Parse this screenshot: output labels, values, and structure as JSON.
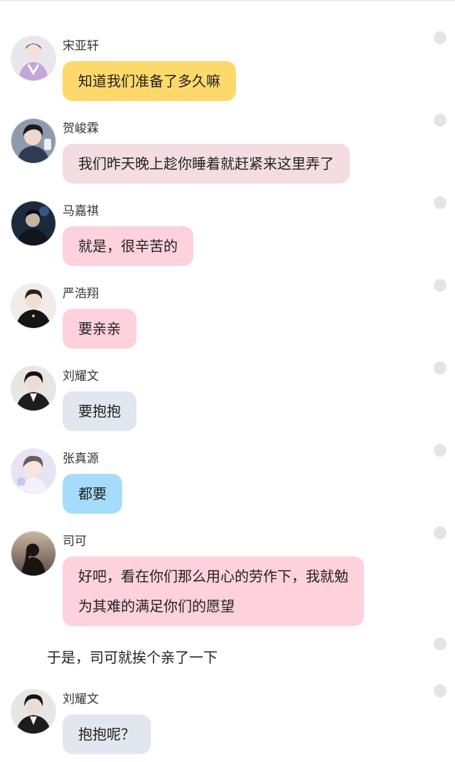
{
  "messages": [
    {
      "name": "宋亚轩",
      "text": "知道我们准备了多久嘛",
      "bubble_color": "#fcd96a",
      "avatar": "avatar-purple-sweater"
    },
    {
      "name": "贺峻霖",
      "text": "我们昨天晚上趁你睡着就赶紧来这里弄了",
      "bubble_color": "#f3dde0",
      "avatar": "avatar-dark-hair"
    },
    {
      "name": "马嘉祺",
      "text": "就是，很辛苦的",
      "bubble_color": "#fdd2dc",
      "avatar": "avatar-dark-night"
    },
    {
      "name": "严浩翔",
      "text": "要亲亲",
      "bubble_color": "#fdd2dc",
      "avatar": "avatar-black-outfit"
    },
    {
      "name": "刘耀文",
      "text": "要抱抱",
      "bubble_color": "#e2e6ee",
      "avatar": "avatar-suit"
    },
    {
      "name": "张真源",
      "text": "都要",
      "bubble_color": "#a6dcfb",
      "avatar": "avatar-light"
    },
    {
      "name": "司可",
      "lines": [
        "好吧，看在你们那么用心的劳作下，我就勉",
        "为其难的满足你们的愿望"
      ],
      "bubble_color": "#fdd2dc",
      "avatar": "avatar-silhouette"
    },
    {
      "name": "刘耀文",
      "text": "抱抱呢？",
      "bubble_color": "#e2e6ee",
      "avatar": "avatar-suit"
    }
  ],
  "narration": "于是，司可就挨个亲了一下",
  "colors": {
    "dot": "#e4e4e4",
    "name_text": "#333333",
    "body_text": "#222222"
  }
}
